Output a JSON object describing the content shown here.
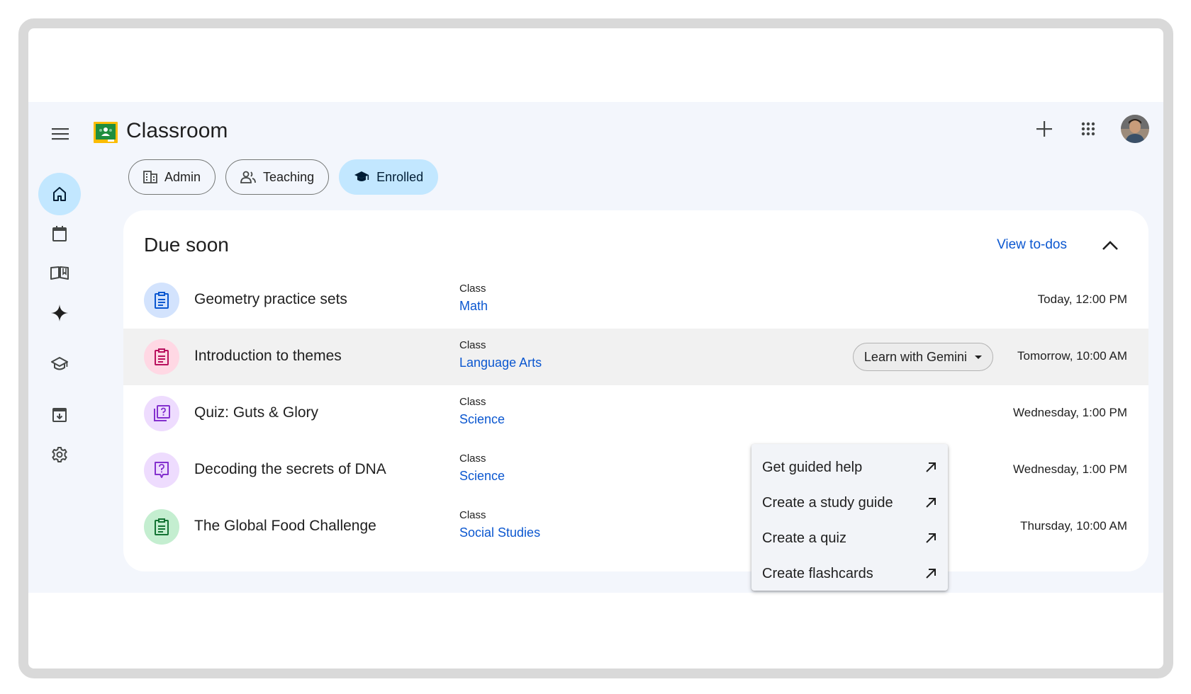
{
  "app": {
    "title": "Classroom"
  },
  "chips": [
    {
      "label": "Admin",
      "icon": "building-icon",
      "selected": false
    },
    {
      "label": "Teaching",
      "icon": "people-icon",
      "selected": false
    },
    {
      "label": "Enrolled",
      "icon": "graduation-cap-icon",
      "selected": true
    }
  ],
  "rail": [
    {
      "name": "home",
      "icon": "home-icon",
      "active": true
    },
    {
      "name": "calendar",
      "icon": "calendar-icon",
      "active": false
    },
    {
      "name": "library",
      "icon": "open-book-icon",
      "active": false
    },
    {
      "name": "gemini",
      "icon": "sparkle-icon",
      "active": false
    },
    {
      "name": "enrolled",
      "icon": "graduation-cap-icon",
      "active": false
    },
    {
      "name": "archive",
      "icon": "archive-icon",
      "active": false
    },
    {
      "name": "settings",
      "icon": "settings-icon",
      "active": false
    }
  ],
  "due_soon": {
    "title": "Due soon",
    "view_todos": "View to-dos",
    "class_label": "Class",
    "items": [
      {
        "title": "Geometry practice sets",
        "class": "Math",
        "due": "Today, 12:00 PM",
        "icon": "assignment-icon",
        "icon_color": "#0b57d0",
        "icon_bg": "#d3e3fd"
      },
      {
        "title": "Introduction to themes",
        "class": "Language Arts",
        "due": "Tomorrow, 10:00 AM",
        "icon": "assignment-icon",
        "icon_color": "#b9105e",
        "icon_bg": "#ffd8e4"
      },
      {
        "title": "Quiz: Guts & Glory",
        "class": "Science",
        "due": "Wednesday, 1:00 PM",
        "icon": "quiz-stack-icon",
        "icon_color": "#8430ce",
        "icon_bg": "#eedcfe"
      },
      {
        "title": "Decoding the secrets of DNA",
        "class": "Science",
        "due": "Wednesday, 1:00 PM",
        "icon": "question-icon",
        "icon_color": "#8430ce",
        "icon_bg": "#eedcfe"
      },
      {
        "title": "The Global Food Challenge",
        "class": "Social Studies",
        "due": "Thursday, 10:00 AM",
        "icon": "assignment-icon",
        "icon_color": "#137333",
        "icon_bg": "#c4eed0"
      }
    ]
  },
  "gemini": {
    "button_label": "Learn with Gemini",
    "menu": [
      {
        "label": "Get guided help",
        "icon": "arrow-outward-icon"
      },
      {
        "label": "Create a study guide",
        "icon": "arrow-outward-icon"
      },
      {
        "label": "Create a quiz",
        "icon": "arrow-outward-icon"
      },
      {
        "label": "Create flashcards",
        "icon": "arrow-outward-icon"
      }
    ]
  },
  "colors": {
    "accent": "#0b57d0",
    "chip_selected": "#c2e7ff",
    "surface": "#f3f6fc"
  }
}
